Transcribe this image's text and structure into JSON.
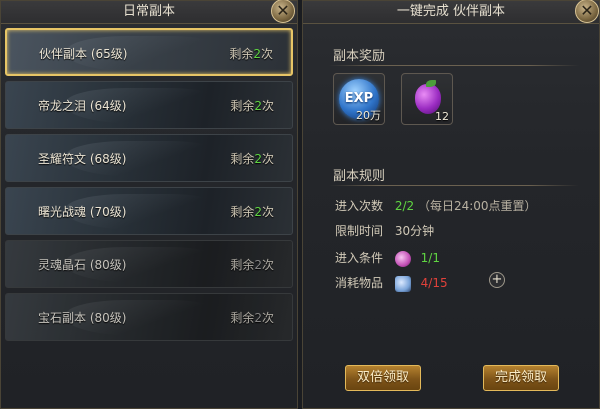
{
  "left_panel": {
    "title": "日常副本",
    "close_label": "✕",
    "dungeons": [
      {
        "name": "伙伴副本",
        "level": "(65级)",
        "remaining_prefix": "剩余",
        "remaining_count": "2",
        "remaining_suffix": "次",
        "state": "selected"
      },
      {
        "name": "帝龙之泪",
        "level": "(64级)",
        "remaining_prefix": "剩余",
        "remaining_count": "2",
        "remaining_suffix": "次",
        "state": "available"
      },
      {
        "name": "圣耀符文",
        "level": "(68级)",
        "remaining_prefix": "剩余",
        "remaining_count": "2",
        "remaining_suffix": "次",
        "state": "available"
      },
      {
        "name": "曙光战魂",
        "level": "(70级)",
        "remaining_prefix": "剩余",
        "remaining_count": "2",
        "remaining_suffix": "次",
        "state": "available"
      },
      {
        "name": "灵魂晶石",
        "level": "(80级)",
        "remaining_prefix": "剩余",
        "remaining_count": "2",
        "remaining_suffix": "次",
        "state": "locked"
      },
      {
        "name": "宝石副本",
        "level": "(80级)",
        "remaining_prefix": "剩余",
        "remaining_count": "2",
        "remaining_suffix": "次",
        "state": "locked"
      }
    ]
  },
  "right_panel": {
    "title": "一键完成  伙伴副本",
    "close_label": "✕",
    "rewards": {
      "title": "副本奖励",
      "items": [
        {
          "icon": "exp-orb-icon",
          "icon_text": "EXP",
          "quantity": "20万"
        },
        {
          "icon": "purple-grape-icon",
          "quantity": "12"
        }
      ]
    },
    "rules": {
      "title": "副本规则",
      "entries": {
        "label": "进入次数",
        "value": "2/2",
        "note": "（每日24:00点重置）"
      },
      "time_limit": {
        "label": "限制时间",
        "value": "30分钟"
      },
      "condition": {
        "label": "进入条件",
        "icon": "pet-icon",
        "value": "1/1"
      },
      "consume": {
        "label": "消耗物品",
        "icon": "item-icon",
        "value": "4/15",
        "add_label": "+"
      }
    },
    "buttons": {
      "double_claim": "双倍领取",
      "finish_claim": "完成领取"
    }
  },
  "colors": {
    "highlight_border": "#e7c566",
    "green_count": "#5fd442",
    "red_count": "#e0413a",
    "button_gold": "#b5822f"
  }
}
